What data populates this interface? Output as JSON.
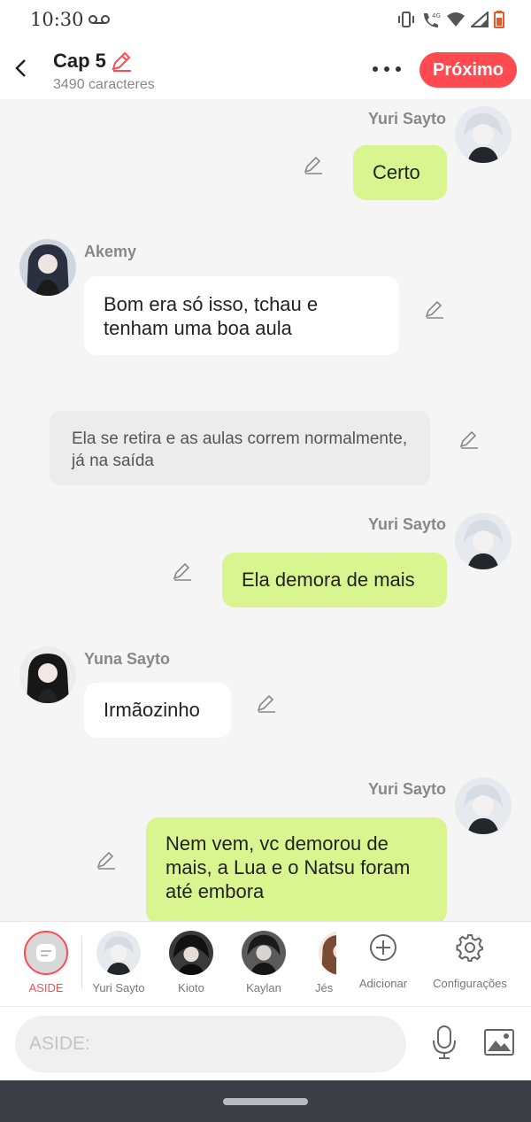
{
  "status": {
    "time": "10:30"
  },
  "header": {
    "title": "Cap 5",
    "char_count": "3490 caracteres",
    "next_label": "Próximo"
  },
  "messages": [
    {
      "speaker": "Yuri Sayto",
      "text": "Certo"
    },
    {
      "speaker": "Akemy",
      "text": "Bom era só isso, tchau e tenham uma boa aula"
    },
    {
      "speaker": "",
      "text": "Ela se retira e as aulas correm normalmente, já na saída"
    },
    {
      "speaker": "Yuri Sayto",
      "text": "Ela demora de mais"
    },
    {
      "speaker": "Yuna Sayto",
      "text": "Irmãozinho"
    },
    {
      "speaker": "Yuri Sayto",
      "text": "Nem vem, vc demorou de mais, a Lua e o Natsu foram até embora"
    }
  ],
  "characters": [
    {
      "label": "ASIDE"
    },
    {
      "label": "Yuri Sayto"
    },
    {
      "label": "Kioto"
    },
    {
      "label": "Kaylan"
    },
    {
      "label": "Jés"
    },
    {
      "label": "Adicionar"
    },
    {
      "label": "Configurações"
    }
  ],
  "input": {
    "placeholder": "ASIDE:"
  },
  "colors": {
    "accent": "#ff4a52",
    "my_bubble": "#d8f58f",
    "other_bubble": "#ffffff",
    "aside_bubble": "#ececec"
  },
  "icons": [
    "voicemail-icon",
    "vibrate-icon",
    "wifi-call-icon",
    "wifi-icon",
    "signal-icon",
    "battery-icon",
    "back-icon",
    "pencil-icon",
    "more-icon",
    "aside-icon",
    "add-icon",
    "gear-icon",
    "mic-icon",
    "image-icon"
  ]
}
